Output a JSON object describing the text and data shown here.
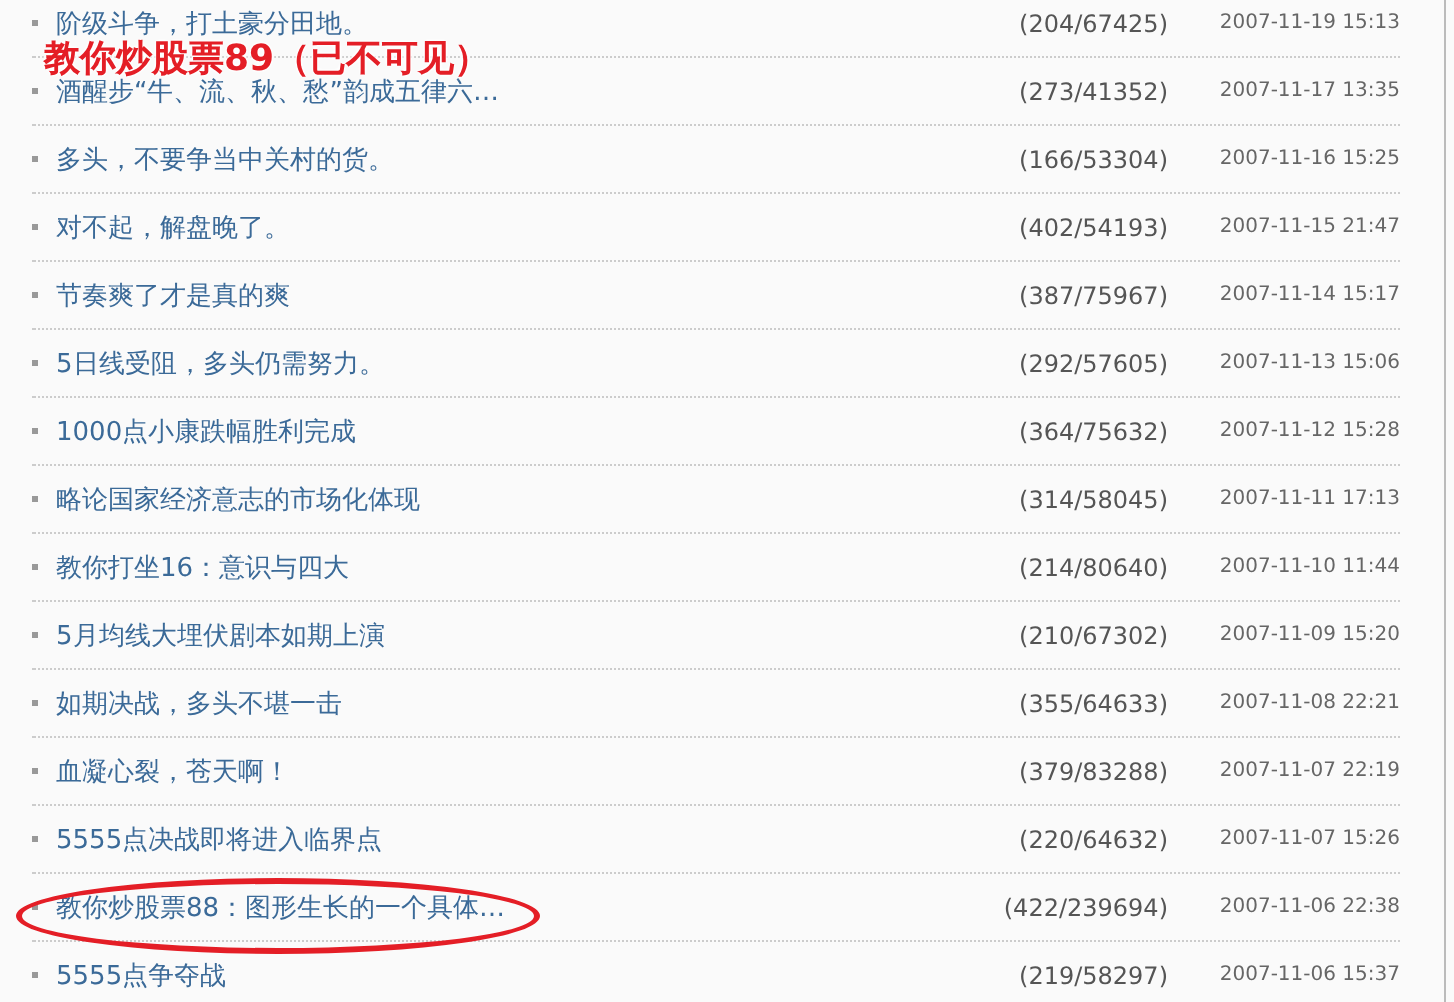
{
  "annotation": {
    "text": "教你炒股票89（已不可见）"
  },
  "posts": [
    {
      "title": "阶级斗争，打土豪分田地。",
      "count": "(204/67425)",
      "date": "2007-11-19 15:13",
      "highlighted": false
    },
    {
      "title": "酒醒步“牛、流、秋、愁”韵成五律六…",
      "count": "(273/41352)",
      "date": "2007-11-17 13:35",
      "highlighted": false
    },
    {
      "title": "多头，不要争当中关村的货。",
      "count": "(166/53304)",
      "date": "2007-11-16 15:25",
      "highlighted": false
    },
    {
      "title": "对不起，解盘晚了。",
      "count": "(402/54193)",
      "date": "2007-11-15 21:47",
      "highlighted": false
    },
    {
      "title": "节奏爽了才是真的爽",
      "count": "(387/75967)",
      "date": "2007-11-14 15:17",
      "highlighted": false
    },
    {
      "title": "5日线受阻，多头仍需努力。",
      "count": "(292/57605)",
      "date": "2007-11-13 15:06",
      "highlighted": false
    },
    {
      "title": "1000点小康跌幅胜利完成",
      "count": "(364/75632)",
      "date": "2007-11-12 15:28",
      "highlighted": false
    },
    {
      "title": "略论国家经济意志的市场化体现",
      "count": "(314/58045)",
      "date": "2007-11-11 17:13",
      "highlighted": false
    },
    {
      "title": "教你打坐16：意识与四大",
      "count": "(214/80640)",
      "date": "2007-11-10 11:44",
      "highlighted": false
    },
    {
      "title": "5月均线大埋伏剧本如期上演",
      "count": "(210/67302)",
      "date": "2007-11-09 15:20",
      "highlighted": false
    },
    {
      "title": "如期决战，多头不堪一击",
      "count": "(355/64633)",
      "date": "2007-11-08 22:21",
      "highlighted": false
    },
    {
      "title": "血凝心裂，苍天啊！",
      "count": "(379/83288)",
      "date": "2007-11-07 22:19",
      "highlighted": false
    },
    {
      "title": "5555点决战即将进入临界点",
      "count": "(220/64632)",
      "date": "2007-11-07 15:26",
      "highlighted": false
    },
    {
      "title": "教你炒股票88：图形生长的一个具体…",
      "count": "(422/239694)",
      "date": "2007-11-06 22:38",
      "highlighted": true
    },
    {
      "title": "5555点争夺战",
      "count": "(219/58297)",
      "date": "2007-11-06 15:37",
      "highlighted": false
    }
  ]
}
